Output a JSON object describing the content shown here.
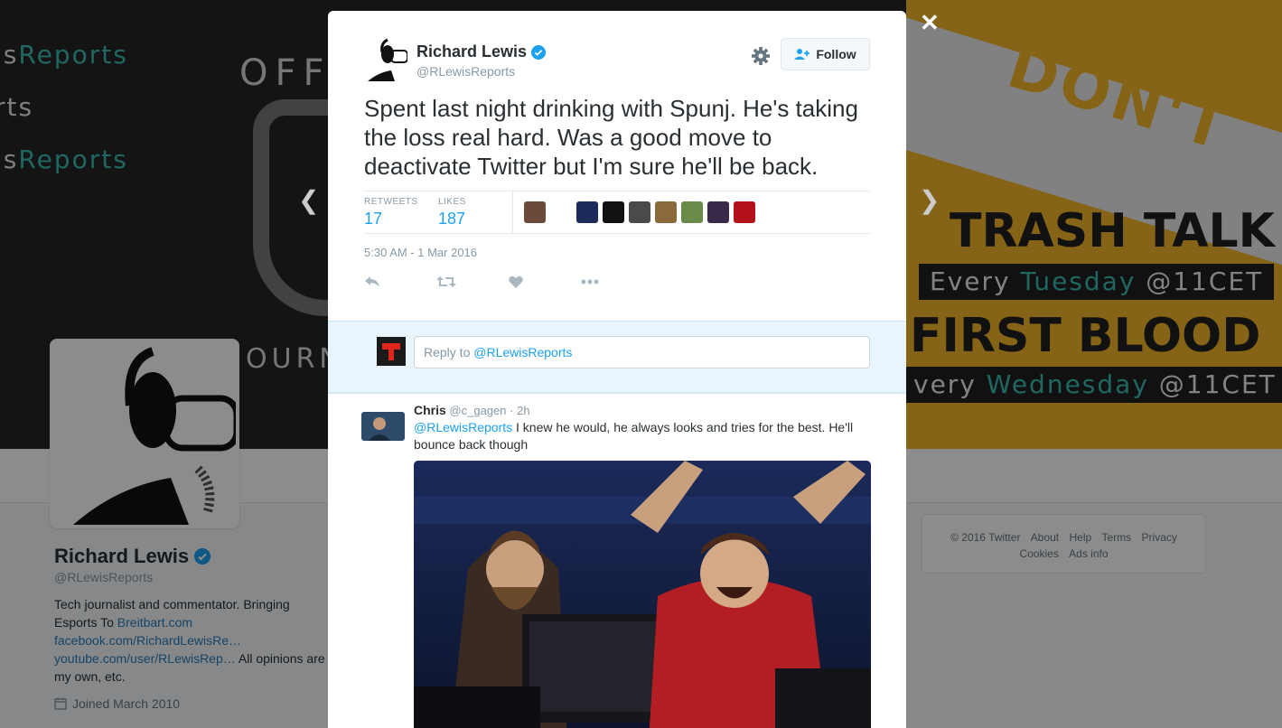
{
  "background": {
    "banner_lines": [
      {
        "white": "is",
        "teal": "Reports"
      },
      {
        "white": "rts",
        "teal": ""
      },
      {
        "white": "is",
        "teal": "Reports"
      }
    ],
    "banner_off": "OFF",
    "banner_journa": "OURNA",
    "promo": {
      "dont": "DON'T",
      "trash_talk": "TRASH TALK",
      "trash_sched_a": "Every ",
      "trash_sched_day": "Tuesday",
      "trash_sched_b": " @11CET",
      "first_blood": "FIRST BLOOD",
      "blood_sched_a": "very ",
      "blood_sched_day": "Wednesday",
      "blood_sched_b": " @11CET"
    },
    "profile": {
      "name": "Richard Lewis",
      "handle": "@RLewisReports",
      "bio_text": "Tech journalist and commentator. Bringing Esports To ",
      "bio_link1": "Breitbart.com",
      "bio_link2": "facebook.com/RichardLewisRe…",
      "bio_link3": "youtube.com/user/RLewisRep…",
      "bio_tail": " All opinions are my own, etc.",
      "joined": "Joined March 2010"
    },
    "footer": {
      "copyright": "© 2016 Twitter",
      "about": "About",
      "help": "Help",
      "terms": "Terms",
      "privacy": "Privacy",
      "cookies": "Cookies",
      "ads": "Ads info"
    }
  },
  "close_label": "✕",
  "tweet": {
    "author_name": "Richard Lewis",
    "author_handle": "@RLewisReports",
    "follow_label": "Follow",
    "text": "Spent last night drinking with Spunj. He's taking the loss real hard. Was a good move to deactivate Twitter but I'm sure he'll be back.",
    "retweets_label": "RETWEETS",
    "retweets": "17",
    "likes_label": "LIKES",
    "likes": "187",
    "liker_colors": [
      "#6b4a3a",
      "#ffffff",
      "#1d2b5a",
      "#111111",
      "#4a4a4a",
      "#8a6a3a",
      "#6a8a4a",
      "#3a2a4a",
      "#b3121d"
    ],
    "timestamp": "5:30 AM - 1 Mar 2016"
  },
  "reply_box": {
    "placeholder_prefix": "Reply to ",
    "placeholder_mention": "@RLewisReports"
  },
  "reply": {
    "name": "Chris",
    "handle": "@c_gagen",
    "time": "2h",
    "mention": "@RLewisReports",
    "text": " I knew he would, he always looks and tries for the best. He'll bounce back though"
  },
  "colors": {
    "accent": "#1da1f2",
    "verified": "#1da1f2",
    "promo_yellow": "#f3b52a"
  }
}
